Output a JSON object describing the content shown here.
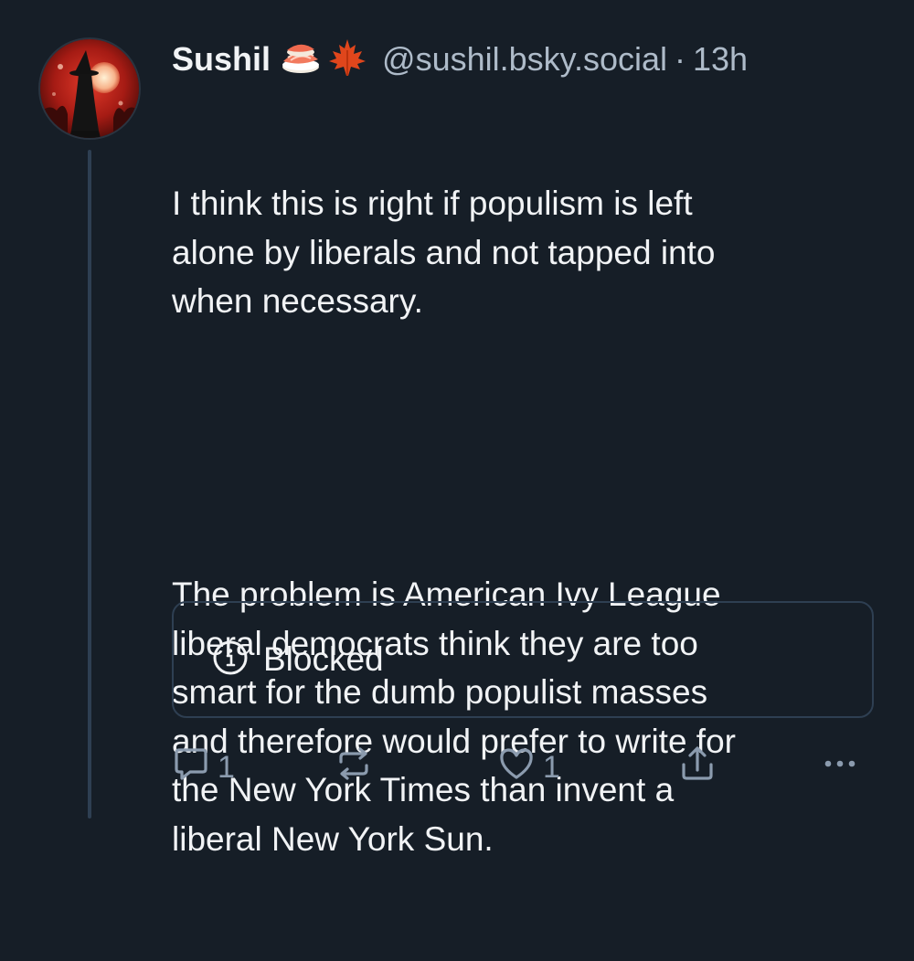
{
  "post": {
    "author": {
      "display_name": "Sushil",
      "name_emojis": [
        "sushi-emoji",
        "maple-leaf-emoji"
      ],
      "handle": "@sushil.bsky.social",
      "separator": "·",
      "timestamp": "13h"
    },
    "text_paragraphs": [
      "I think this is right if populism is left\nalone by liberals and not tapped into\nwhen necessary.",
      "The problem is American Ivy League\nliberal democrats think they are too\nsmart for the dumb populist masses\nand therefore would prefer to write for\nthe New York Times than invent a\nliberal New York Sun."
    ],
    "embed": {
      "icon": "info-icon",
      "label": "Blocked"
    },
    "actions": {
      "reply": {
        "icon": "reply-icon",
        "count": "1"
      },
      "repost": {
        "icon": "repost-icon",
        "count": ""
      },
      "like": {
        "icon": "heart-icon",
        "count": "1"
      },
      "share": {
        "icon": "share-icon"
      },
      "more": {
        "icon": "more-icon"
      }
    }
  },
  "colors": {
    "background": "#161e27",
    "text": "#f1f3f5",
    "muted": "#aebbc9",
    "icon": "#8b9bae",
    "border": "#2e3f52"
  }
}
